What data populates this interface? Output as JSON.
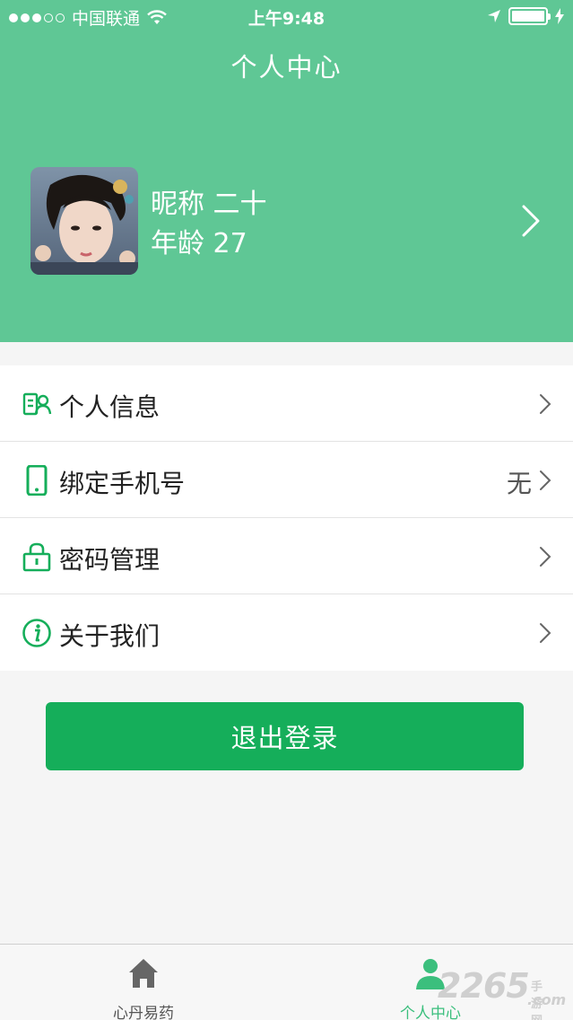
{
  "status_bar": {
    "carrier": "中国联通",
    "time": "上午9:48"
  },
  "nav": {
    "title": "个人中心"
  },
  "profile": {
    "nickname": "昵称 二十",
    "age": "年龄 27"
  },
  "menu": [
    {
      "label": "个人信息",
      "value": "",
      "icon": "profile-card-icon"
    },
    {
      "label": "绑定手机号",
      "value": "无",
      "icon": "phone-icon"
    },
    {
      "label": "密码管理",
      "value": "",
      "icon": "lock-icon"
    },
    {
      "label": "关于我们",
      "value": "",
      "icon": "info-icon"
    }
  ],
  "logout_label": "退出登录",
  "tabbar": {
    "home_label": "心丹易药",
    "me_label": "个人中心"
  },
  "watermark": {
    "number": "2265",
    "small": "手游网",
    "domain": ".com"
  },
  "colors": {
    "header": "#5fc795",
    "accent": "#15ae5a",
    "active_tab": "#3bbf7d"
  }
}
